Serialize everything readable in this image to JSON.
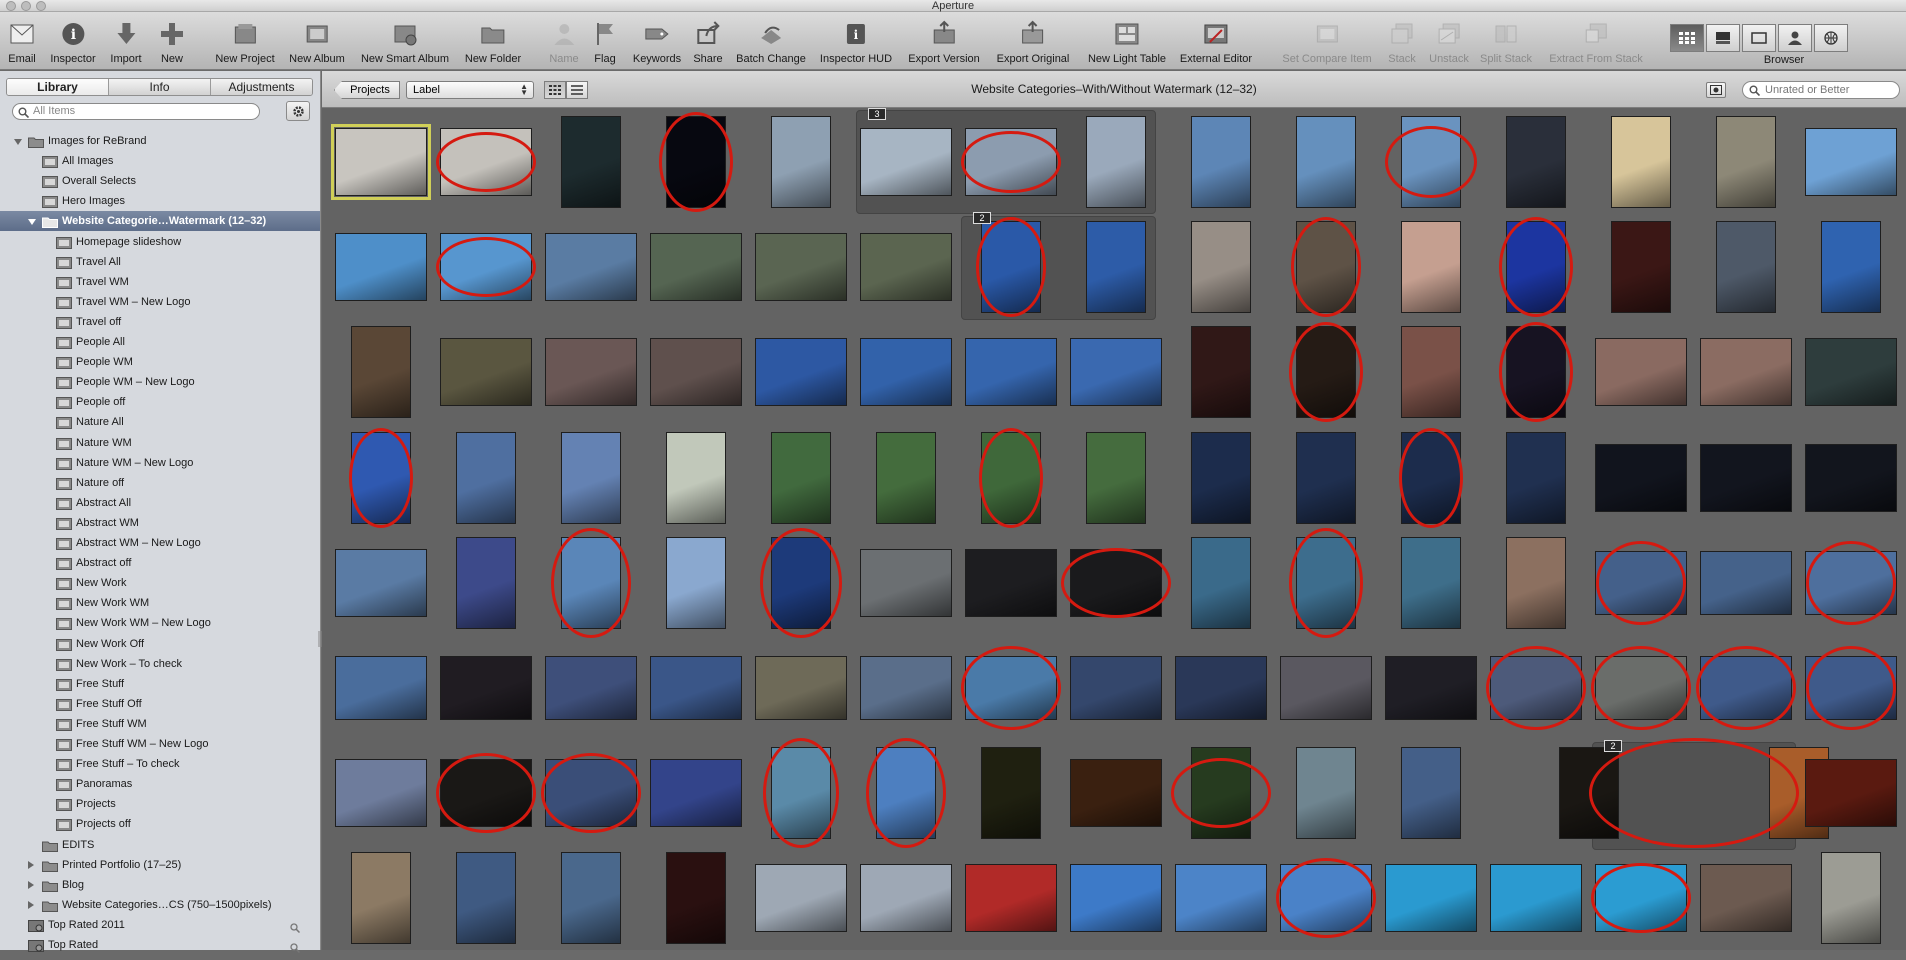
{
  "window": {
    "title": "Aperture"
  },
  "toolbar": {
    "items": [
      {
        "label": "Email",
        "icon": "email-icon"
      },
      {
        "label": "Inspector",
        "icon": "inspector-icon"
      },
      {
        "label": "Import",
        "icon": "import-icon"
      },
      {
        "label": "New",
        "icon": "new-icon"
      },
      {
        "label": "New Project",
        "icon": "new-project-icon"
      },
      {
        "label": "New Album",
        "icon": "new-album-icon"
      },
      {
        "label": "New Smart Album",
        "icon": "new-smart-album-icon"
      },
      {
        "label": "New Folder",
        "icon": "new-folder-icon"
      },
      {
        "label": "Name",
        "icon": "name-icon"
      },
      {
        "label": "Flag",
        "icon": "flag-icon"
      },
      {
        "label": "Keywords",
        "icon": "keywords-icon"
      },
      {
        "label": "Share",
        "icon": "share-icon"
      },
      {
        "label": "Batch Change",
        "icon": "batch-change-icon"
      },
      {
        "label": "Inspector HUD",
        "icon": "inspector-hud-icon"
      },
      {
        "label": "Export Version",
        "icon": "export-version-icon"
      },
      {
        "label": "Export Original",
        "icon": "export-original-icon"
      },
      {
        "label": "New Light Table",
        "icon": "new-light-table-icon"
      },
      {
        "label": "External Editor",
        "icon": "external-editor-icon"
      },
      {
        "label": "Set Compare Item",
        "icon": "set-compare-item-icon"
      },
      {
        "label": "Stack",
        "icon": "stack-icon"
      },
      {
        "label": "Unstack",
        "icon": "unstack-icon"
      },
      {
        "label": "Split Stack",
        "icon": "split-stack-icon"
      },
      {
        "label": "Extract From Stack",
        "icon": "extract-from-stack-icon"
      }
    ],
    "view_switcher_label": "Browser"
  },
  "sidebar": {
    "tabs": [
      "Library",
      "Info",
      "Adjustments"
    ],
    "active_tab": "Library",
    "search_placeholder": "All Items",
    "items": [
      {
        "label": "Images for ReBrand",
        "level": 0,
        "kind": "folder",
        "expanded": true
      },
      {
        "label": "All Images",
        "level": 1,
        "kind": "album"
      },
      {
        "label": "Overall Selects",
        "level": 1,
        "kind": "album"
      },
      {
        "label": "Hero Images",
        "level": 1,
        "kind": "album"
      },
      {
        "label": "Website Categorie…Watermark (12–32)",
        "level": 1,
        "kind": "folder",
        "expanded": true,
        "selected": true
      },
      {
        "label": "Homepage slideshow",
        "level": 2,
        "kind": "album"
      },
      {
        "label": "Travel All",
        "level": 2,
        "kind": "album"
      },
      {
        "label": "Travel WM",
        "level": 2,
        "kind": "album"
      },
      {
        "label": "Travel WM – New Logo",
        "level": 2,
        "kind": "album"
      },
      {
        "label": "Travel off",
        "level": 2,
        "kind": "album"
      },
      {
        "label": "People All",
        "level": 2,
        "kind": "album"
      },
      {
        "label": "People WM",
        "level": 2,
        "kind": "album"
      },
      {
        "label": "People WM – New Logo",
        "level": 2,
        "kind": "album"
      },
      {
        "label": "People off",
        "level": 2,
        "kind": "album"
      },
      {
        "label": "Nature All",
        "level": 2,
        "kind": "album"
      },
      {
        "label": "Nature WM",
        "level": 2,
        "kind": "album"
      },
      {
        "label": "Nature WM – New Logo",
        "level": 2,
        "kind": "album"
      },
      {
        "label": "Nature off",
        "level": 2,
        "kind": "album"
      },
      {
        "label": "Abstract All",
        "level": 2,
        "kind": "album"
      },
      {
        "label": "Abstract WM",
        "level": 2,
        "kind": "album"
      },
      {
        "label": "Abstract WM – New Logo",
        "level": 2,
        "kind": "album"
      },
      {
        "label": "Abstract off",
        "level": 2,
        "kind": "album"
      },
      {
        "label": "New Work",
        "level": 2,
        "kind": "album"
      },
      {
        "label": "New Work WM",
        "level": 2,
        "kind": "album"
      },
      {
        "label": "New Work WM – New Logo",
        "level": 2,
        "kind": "album"
      },
      {
        "label": "New Work Off",
        "level": 2,
        "kind": "album"
      },
      {
        "label": "New Work – To check",
        "level": 2,
        "kind": "album"
      },
      {
        "label": "Free Stuff",
        "level": 2,
        "kind": "album"
      },
      {
        "label": "Free Stuff Off",
        "level": 2,
        "kind": "album"
      },
      {
        "label": "Free Stuff WM",
        "level": 2,
        "kind": "album"
      },
      {
        "label": "Free Stuff WM – New Logo",
        "level": 2,
        "kind": "album"
      },
      {
        "label": "Free Stuff – To check",
        "level": 2,
        "kind": "album"
      },
      {
        "label": "Panoramas",
        "level": 2,
        "kind": "album"
      },
      {
        "label": "Projects",
        "level": 2,
        "kind": "album"
      },
      {
        "label": "Projects off",
        "level": 2,
        "kind": "album"
      },
      {
        "label": "EDITS",
        "level": 1,
        "kind": "folder"
      },
      {
        "label": "Printed Portfolio (17–25)",
        "level": 1,
        "kind": "folder",
        "expanded": false
      },
      {
        "label": "Blog",
        "level": 1,
        "kind": "folder",
        "expanded": false
      },
      {
        "label": "Website Categories…CS (750–1500pixels)",
        "level": 1,
        "kind": "folder",
        "expanded": false
      },
      {
        "label": "Top Rated 2011",
        "level": 0,
        "kind": "smart-album"
      },
      {
        "label": "Top Rated",
        "level": 0,
        "kind": "smart-album"
      }
    ]
  },
  "browser": {
    "projects_button": "Projects",
    "sort_label": "Label",
    "title": "Website Categories–With/Without Watermark (12–32)",
    "filter_placeholder": "Unrated or Better",
    "stack_badges": [
      "3",
      "2",
      "2"
    ],
    "rows": [
      [
        "#c8c5bf",
        "#c4c1bb",
        "#1d2b2e",
        "#070810",
        "#8ea0b2",
        "#a7b5c3",
        "#8c9caf",
        "#9aa9bb",
        "#5d86b6",
        "#6590bd",
        "#6a93bf",
        "#2a2f3a",
        "#d7c59a",
        "#8d8877",
        "#6ea1d4"
      ],
      [
        "#4e8fc9",
        "#5796cf",
        "#5a7ca3",
        "#556552",
        "#5a6552",
        "#5b6550",
        "#2a59a8",
        "#2d5ca8",
        "#978e86",
        "#5e5246",
        "#c59f90",
        "#1c35a0",
        "#3b1715",
        "#4e5968",
        "#2f63b0"
      ],
      [
        "#5a4736",
        "#5a5640",
        "#6a5755",
        "#5f504d",
        "#2d58a3",
        "#3262aa",
        "#3565ad",
        "#3a69b0",
        "#301817",
        "#251b15",
        "#7a5148",
        "#171322",
        "#8a6a61",
        "#8b6c62",
        "#2e3d3d"
      ],
      [
        "#2f59b1",
        "#4f6fa0",
        "#6482b3",
        "#c1c8ba",
        "#416a3e",
        "#446c3d",
        "#3f683a",
        "#456c3e",
        "#1c2c4c",
        "#1f2f4f",
        "#1c2c4c",
        "#203050",
        "#11141d",
        "#12151e",
        "#12151d"
      ],
      [
        "#5a7ba4",
        "#3d4a8a",
        "#5a86b8",
        "#8aa8cf",
        "#1d3a7a",
        "#6b6f72",
        "#1d1d20",
        "#1a1a1c",
        "#3a6a8a",
        "#3d6d8d",
        "#3e6e8a",
        "#8c7060",
        "#44608a",
        "#45628a",
        "#4e6f9d"
      ],
      [
        "#4a6d9c",
        "#201c22",
        "#3e4f7a",
        "#3a5688",
        "#6e6a58",
        "#5a6e8a",
        "#4a7aa8",
        "#34476c",
        "#2a3858",
        "#5a5860",
        "#1f1e25",
        "#4d5a7a",
        "#6a6d6a",
        "#3f5a8a",
        "#3f5a8a"
      ],
      [
        "#6e7c9c",
        "#1a1816",
        "#3a4e78",
        "#33448a",
        "#5a8aa8",
        "#4d7fc0",
        "#1f2010",
        "#3a2010",
        "#263b1f",
        "#6f8590",
        "#445f88",
        "#1a1713",
        "#a95d2a",
        "#5a1a10"
      ],
      [
        "#8c7a64",
        "#3f5a82",
        "#4a688c",
        "#2a1010",
        "#9ea8b4",
        "#9ea8b5",
        "#b12a28",
        "#3d7ac8",
        "#4c84c8",
        "#4a82c8",
        "#2a9ad0",
        "#2b9ad0",
        "#2b9cd2",
        "#6c5a50",
        "#9c9c94"
      ]
    ]
  }
}
